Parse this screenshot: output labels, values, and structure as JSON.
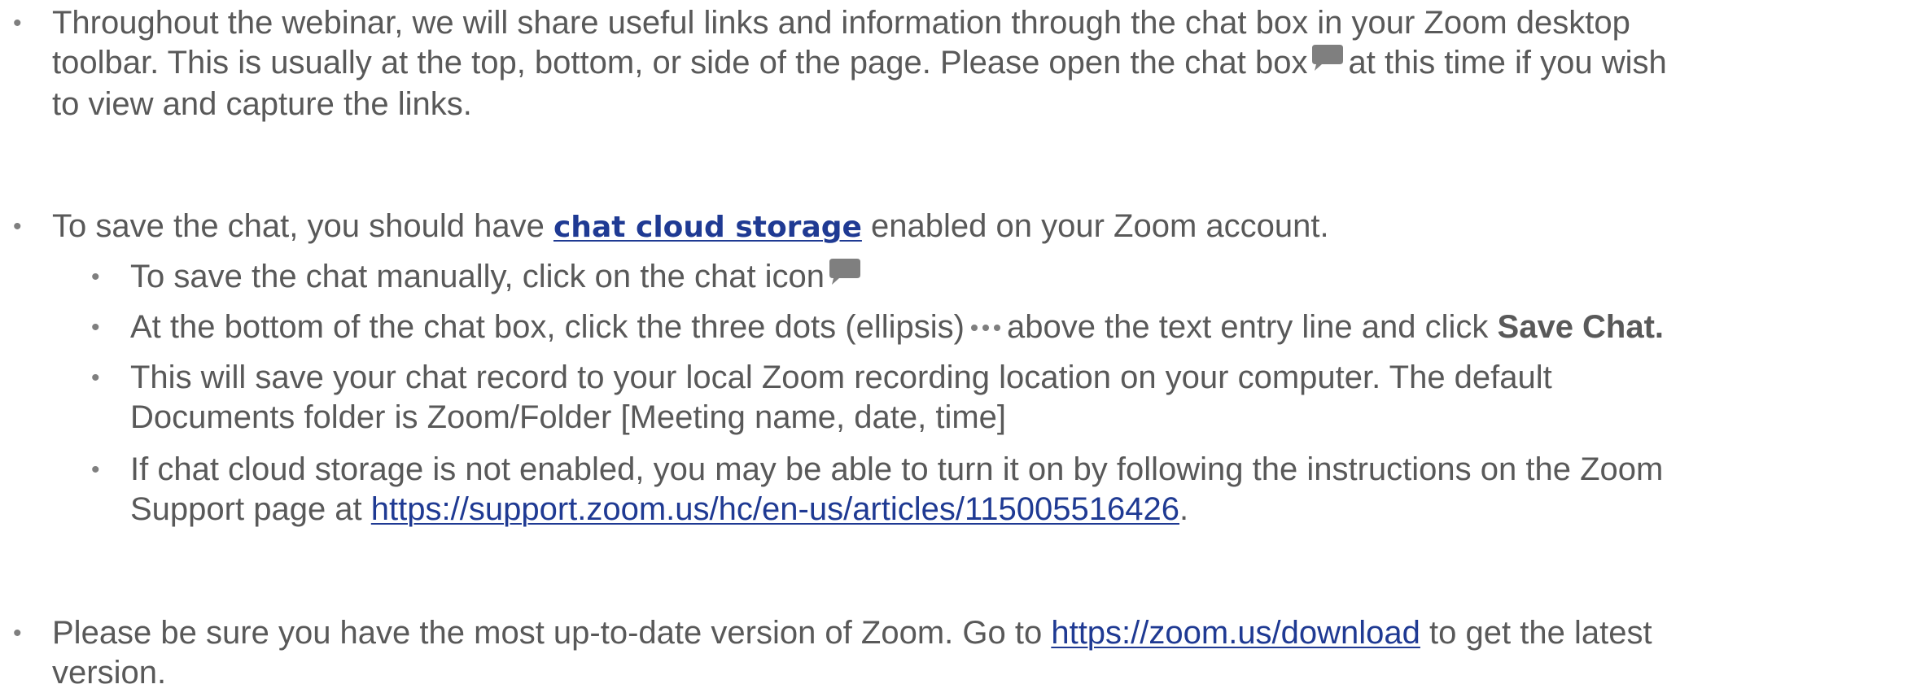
{
  "colors": {
    "text": "#595959",
    "link": "#1f3a93",
    "bullet": "#7f7f7f",
    "icon": "#7f7f7f"
  },
  "bullets": {
    "b1": {
      "line1": "Throughout the webinar, we will share useful links and information through the chat box in your Zoom desktop",
      "line2_before_icon": "toolbar. This is usually at the top, bottom, or side of the page. Please open the chat box",
      "line2_after_icon": "at this time if you wish",
      "line3": "to view and capture the links.",
      "icon": "chat-bubble-icon"
    },
    "b2": {
      "before_link": "To save the chat, you should have ",
      "link_text": "chat cloud storage",
      "after_link": " enabled on your Zoom account."
    },
    "b2a": {
      "text": "To save the chat manually,  click on the chat icon",
      "icon": "chat-bubble-icon"
    },
    "b2b": {
      "before_icon": "At the bottom of the chat box, click the three dots (ellipsis)",
      "after_icon": "above the text entry line and click ",
      "bold": "Save Chat.",
      "icon": "ellipsis-icon"
    },
    "b2c": {
      "line1": "This will save your chat record to your local Zoom recording location on your computer. The default",
      "line2": "Documents folder is Zoom/Folder [Meeting name, date, time]"
    },
    "b2d": {
      "line1": "If chat cloud storage is not enabled, you may be able to turn it on by following  the instructions on the Zoom",
      "line2_before_link": "Support page at ",
      "link_text": "https://support.zoom.us/hc/en-us/articles/115005516426",
      "line2_after_link": "."
    },
    "b3": {
      "before_link": "Please be sure you have the most up-to-date version of Zoom. Go to ",
      "link_text": "https://zoom.us/download",
      "after_link": "  to get the latest",
      "line2": "version."
    }
  }
}
